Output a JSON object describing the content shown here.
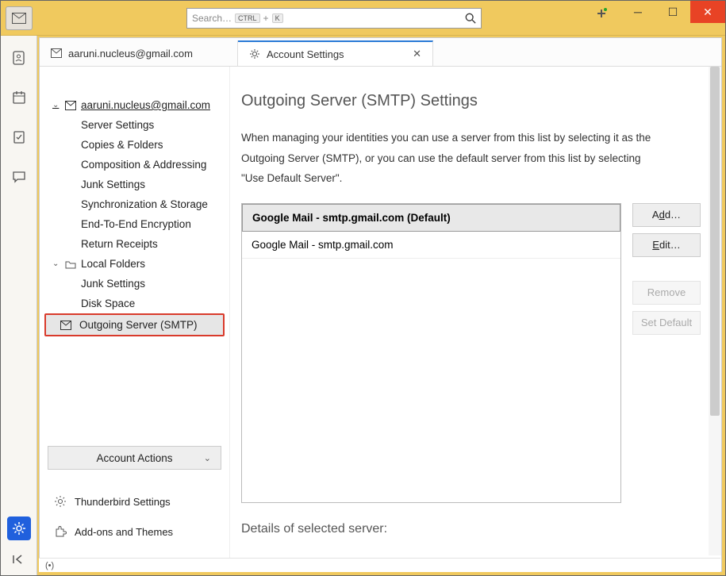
{
  "search": {
    "placeholder": "Search…",
    "kbd1": "CTRL",
    "kbd_plus": "+",
    "kbd2": "K"
  },
  "tabs": {
    "mail": {
      "label": "aaruni.nucleus@gmail.com"
    },
    "settings": {
      "label": "Account Settings"
    }
  },
  "tree": {
    "account": "aaruni.nucleus@gmail.com",
    "items": {
      "server_settings": "Server Settings",
      "copies_folders": "Copies & Folders",
      "composition": "Composition & Addressing",
      "junk": "Junk Settings",
      "sync": "Synchronization & Storage",
      "e2e": "End-To-End Encryption",
      "return_receipts": "Return Receipts"
    },
    "local_folders": "Local Folders",
    "local_items": {
      "junk": "Junk Settings",
      "disk": "Disk Space"
    },
    "smtp": "Outgoing Server (SMTP)",
    "account_actions": "Account Actions",
    "tb_settings": "Thunderbird Settings",
    "addons": "Add-ons and Themes"
  },
  "page": {
    "title": "Outgoing Server (SMTP) Settings",
    "desc": "When managing your identities you can use a server from this list by selecting it as the Outgoing Server (SMTP), or you can use the default server from this list by selecting \"Use Default Server\".",
    "details_header": "Details of selected server:"
  },
  "smtp_list": [
    {
      "label": "Google Mail - smtp.gmail.com (Default)",
      "selected": true
    },
    {
      "label": "Google Mail - smtp.gmail.com",
      "selected": false
    }
  ],
  "buttons": {
    "add_pre": "A",
    "add_u": "d",
    "add_post": "d…",
    "edit_pre": "",
    "edit_u": "E",
    "edit_post": "dit…",
    "remove": "Remove",
    "set_default": "Set Default"
  },
  "status": {
    "text": "(•)"
  }
}
